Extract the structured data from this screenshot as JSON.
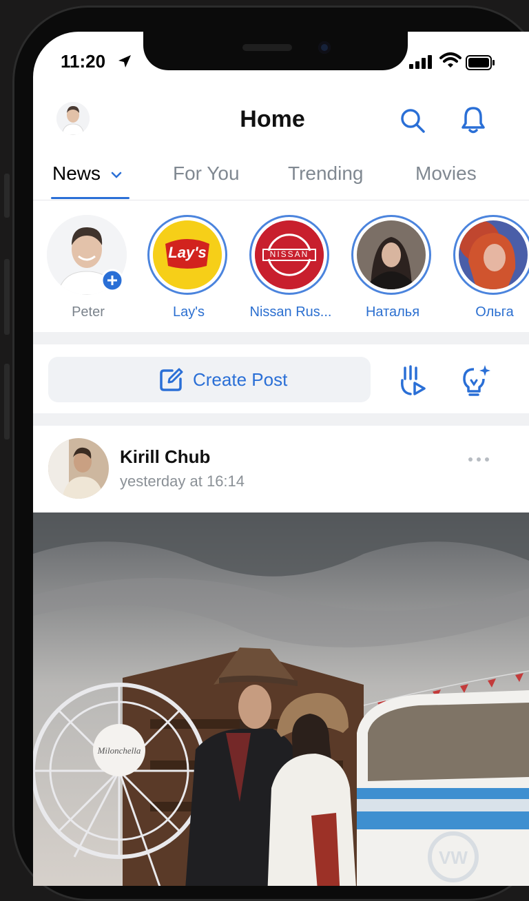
{
  "status_bar": {
    "time": "11:20"
  },
  "header": {
    "title": "Home"
  },
  "tabs": [
    {
      "label": "News",
      "active": true
    },
    {
      "label": "For You",
      "active": false
    },
    {
      "label": "Trending",
      "active": false
    },
    {
      "label": "Movies",
      "active": false
    }
  ],
  "stories": [
    {
      "label": "Peter"
    },
    {
      "label": "Lay's"
    },
    {
      "label": "Nissan Rus..."
    },
    {
      "label": "Наталья"
    },
    {
      "label": "Ольга"
    }
  ],
  "logos": {
    "lays": "Lay's",
    "nissan": "NISSAN"
  },
  "create_post": {
    "label": "Create Post"
  },
  "post": {
    "author": "Kirill Chub",
    "time": "yesterday at 16:14",
    "image_sign": "Milonchella"
  },
  "colors": {
    "accent": "#2a6fd6",
    "ring": "#4b84dd"
  }
}
